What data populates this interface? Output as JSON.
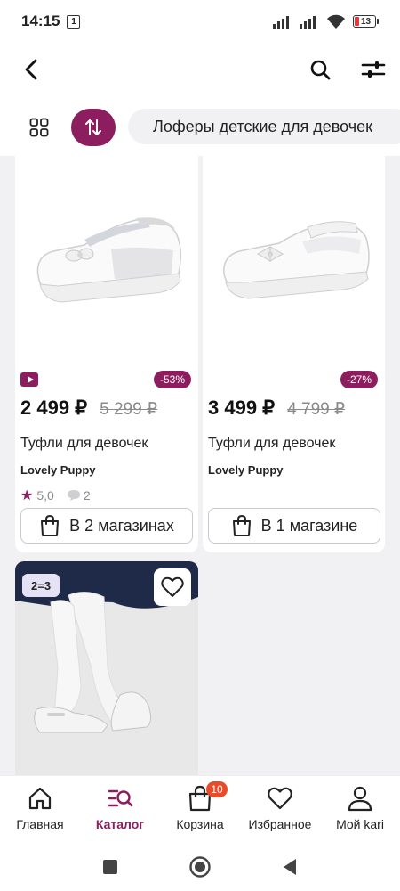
{
  "status": {
    "time": "14:15",
    "sim": "1",
    "battery": "13"
  },
  "filters": {
    "category": "Лоферы детские для девочек"
  },
  "products": [
    {
      "price": "2 499 ₽",
      "old_price": "5 299 ₽",
      "discount": "-53%",
      "title": "Туфли для девочек",
      "brand": "Lovely Puppy",
      "rating": "5,0",
      "reviews": "2",
      "stores": "В 2 магазинах"
    },
    {
      "price": "3 499 ₽",
      "old_price": "4 799 ₽",
      "discount": "-27%",
      "title": "Туфли для девочек",
      "brand": "Lovely Puppy",
      "stores": "В 1 магазине"
    }
  ],
  "promo": {
    "badge": "2=3"
  },
  "nav": {
    "home": "Главная",
    "catalog": "Каталог",
    "cart": "Корзина",
    "cart_count": "10",
    "favorites": "Избранное",
    "profile": "Мой kari"
  },
  "colors": {
    "accent": "#8c1d5e",
    "badge": "#e84b2a",
    "background": "#f1f1f3"
  }
}
